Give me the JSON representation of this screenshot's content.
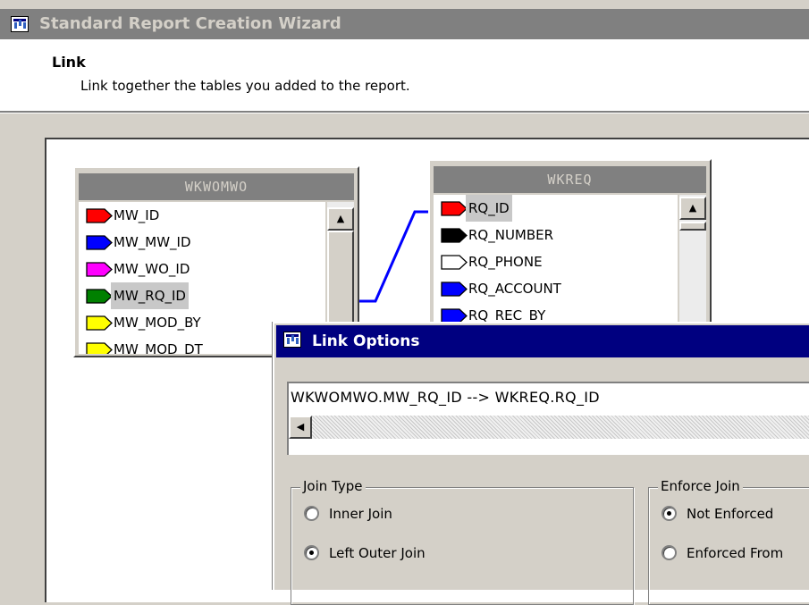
{
  "wizard": {
    "title": "Standard Report Creation Wizard",
    "step_title": "Link",
    "step_description": "Link together the tables you added to the report."
  },
  "tables": {
    "left": {
      "name": "WKWOMWO",
      "fields": [
        {
          "label": "MW_ID",
          "color": "#ff0000"
        },
        {
          "label": "MW_MW_ID",
          "color": "#0000ff"
        },
        {
          "label": "MW_WO_ID",
          "color": "#ff00ff"
        },
        {
          "label": "MW_RQ_ID",
          "color": "#008000"
        },
        {
          "label": "MW_MOD_BY",
          "color": "#ffff00"
        },
        {
          "label": "MW_MOD_DT",
          "color": "#ffff00"
        }
      ]
    },
    "right": {
      "name": "WKREQ",
      "fields": [
        {
          "label": "RQ_ID",
          "color": "#ff0000"
        },
        {
          "label": "RQ_NUMBER",
          "color": "#000000"
        },
        {
          "label": "RQ_PHONE",
          "color": "#ffffff"
        },
        {
          "label": "RQ_ACCOUNT",
          "color": "#0000ff"
        },
        {
          "label": "RQ_REC_BY",
          "color": "#0000ff"
        }
      ]
    }
  },
  "link_line_color": "#0000ff",
  "link_options": {
    "title": "Link Options",
    "link_text": "WKWOMWO.MW_RQ_ID --> WKREQ.RQ_ID",
    "join_type": {
      "legend": "Join Type",
      "options": [
        {
          "label": "Inner Join",
          "checked": false
        },
        {
          "label": "Left Outer Join",
          "checked": true
        }
      ]
    },
    "enforce_join": {
      "legend": "Enforce Join",
      "options": [
        {
          "label": "Not Enforced",
          "checked": true
        },
        {
          "label": "Enforced From",
          "checked": false
        }
      ]
    }
  },
  "icons": {
    "scroll_up": "▲",
    "scroll_left": "◀"
  }
}
